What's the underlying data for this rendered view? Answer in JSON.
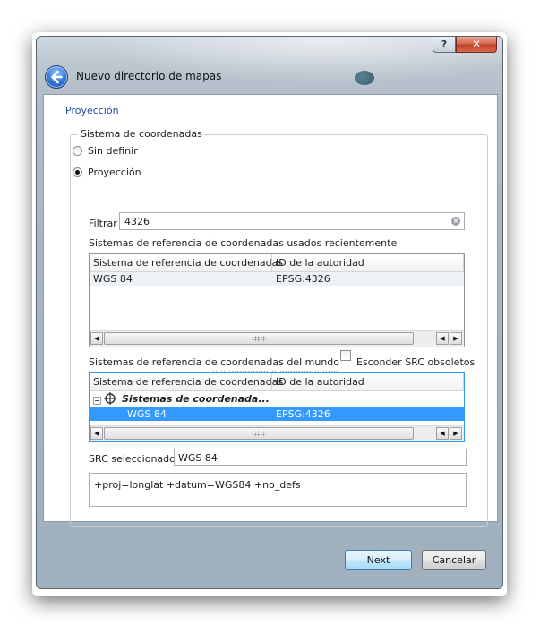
{
  "window": {
    "title": "Nuevo directorio de mapas",
    "help_label": "?",
    "close_label": "✕"
  },
  "page": {
    "section_title": "Proyección"
  },
  "crs_group": {
    "title": "Sistema de coordenadas",
    "options": [
      {
        "label": "Sin definir",
        "selected": false
      },
      {
        "label": "Proyección",
        "selected": true
      }
    ],
    "filter_label": "Filtrar",
    "filter_value": "4326",
    "recent_label": "Sistemas de referencia de coordenadas usados recientemente",
    "recent_table": {
      "columns": [
        "Sistema de referencia de coordenadas",
        "ID de la autoridad"
      ],
      "rows": [
        {
          "crs": "WGS 84",
          "authority_id": "EPSG:4326"
        }
      ]
    },
    "world_label": "Sistemas de referencia de coordenadas del mundo",
    "hide_deprecated_label": "Esconder SRC obsoletos",
    "hide_deprecated_checked": false,
    "world_table": {
      "columns": [
        "Sistema de referencia de coordenadas",
        "ID de la autoridad"
      ],
      "group_node": {
        "toggle": "⊟",
        "label": "Sistemas de coordenada..."
      },
      "rows": [
        {
          "crs": "WGS 84",
          "authority_id": "EPSG:4326",
          "selected": true
        }
      ]
    },
    "selected_label": "SRC seleccionado:",
    "selected_value": "WGS 84",
    "proj_string": "+proj=longlat +datum=WGS84 +no_defs"
  },
  "footer": {
    "next_label": "Next",
    "cancel_label": "Cancelar"
  },
  "scrollbar": {
    "left_arrow": "◀",
    "right_arrow": "▶"
  }
}
